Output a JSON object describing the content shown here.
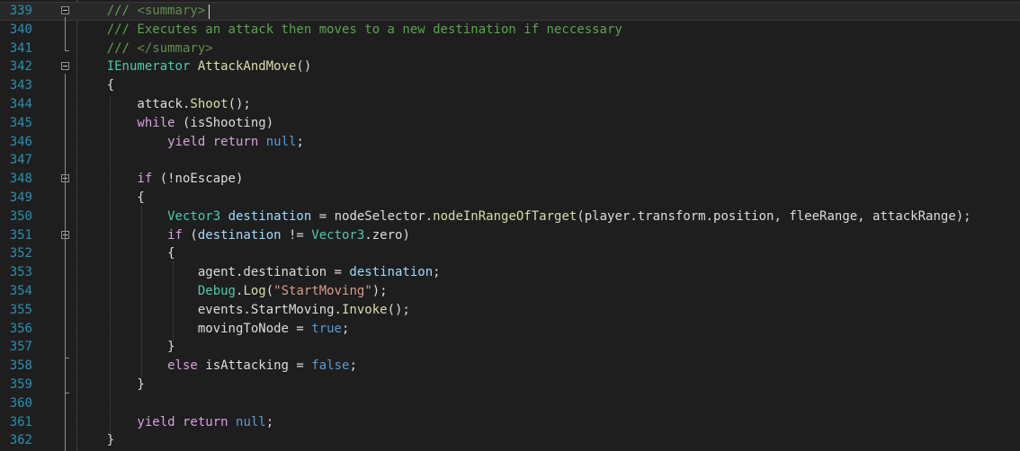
{
  "editor": {
    "theme_colors": {
      "background": "#1e1e1e",
      "line_number": "#2b91af",
      "comment": "#57a64a",
      "keyword": "#569cd6",
      "control_keyword": "#d8a0df",
      "type": "#4ec9b0",
      "method": "#dcdcaa",
      "string": "#d69d85",
      "local_variable": "#9cdcfe",
      "plain": "#dcdcdc"
    },
    "current_line": "339",
    "lines": [
      {
        "n": "339",
        "fold": true,
        "tokens": [
          {
            "t": "/// ",
            "c": "comment"
          },
          {
            "t": "<summary>",
            "c": "xmltag"
          }
        ]
      },
      {
        "n": "340",
        "fold": false,
        "tokens": [
          {
            "t": "/// Executes an attack then moves to a new destination if neccessary",
            "c": "comment"
          }
        ]
      },
      {
        "n": "341",
        "fold": false,
        "tokens": [
          {
            "t": "/// ",
            "c": "comment"
          },
          {
            "t": "</summary>",
            "c": "xmltag"
          }
        ]
      },
      {
        "n": "342",
        "fold": true,
        "tokens": [
          {
            "t": "IEnumerator",
            "c": "type"
          },
          {
            "t": " ",
            "c": "plain"
          },
          {
            "t": "AttackAndMove",
            "c": "method"
          },
          {
            "t": "()",
            "c": "plain"
          }
        ]
      },
      {
        "n": "343",
        "fold": false,
        "tokens": [
          {
            "t": "{",
            "c": "plain"
          }
        ]
      },
      {
        "n": "344",
        "fold": false,
        "tokens": [
          {
            "t": "    attack.",
            "c": "plain"
          },
          {
            "t": "Shoot",
            "c": "method"
          },
          {
            "t": "();",
            "c": "plain"
          }
        ]
      },
      {
        "n": "345",
        "fold": false,
        "tokens": [
          {
            "t": "    ",
            "c": "plain"
          },
          {
            "t": "while",
            "c": "ctrl"
          },
          {
            "t": " (isShooting)",
            "c": "plain"
          }
        ]
      },
      {
        "n": "346",
        "fold": false,
        "tokens": [
          {
            "t": "        ",
            "c": "plain"
          },
          {
            "t": "yield",
            "c": "ctrl"
          },
          {
            "t": " ",
            "c": "plain"
          },
          {
            "t": "return",
            "c": "ctrl"
          },
          {
            "t": " ",
            "c": "plain"
          },
          {
            "t": "null",
            "c": "kw"
          },
          {
            "t": ";",
            "c": "plain"
          }
        ]
      },
      {
        "n": "347",
        "fold": false,
        "tokens": []
      },
      {
        "n": "348",
        "fold": true,
        "tokens": [
          {
            "t": "    ",
            "c": "plain"
          },
          {
            "t": "if",
            "c": "ctrl"
          },
          {
            "t": " (!noEscape)",
            "c": "plain"
          }
        ]
      },
      {
        "n": "349",
        "fold": false,
        "tokens": [
          {
            "t": "    {",
            "c": "plain"
          }
        ]
      },
      {
        "n": "350",
        "fold": false,
        "tokens": [
          {
            "t": "        ",
            "c": "plain"
          },
          {
            "t": "Vector3",
            "c": "type"
          },
          {
            "t": " ",
            "c": "plain"
          },
          {
            "t": "destination",
            "c": "field"
          },
          {
            "t": " = nodeSelector.",
            "c": "plain"
          },
          {
            "t": "nodeInRangeOfTarget",
            "c": "method"
          },
          {
            "t": "(player.transform.position, fleeRange, attackRange);",
            "c": "plain"
          }
        ]
      },
      {
        "n": "351",
        "fold": true,
        "tokens": [
          {
            "t": "        ",
            "c": "plain"
          },
          {
            "t": "if",
            "c": "ctrl"
          },
          {
            "t": " (",
            "c": "plain"
          },
          {
            "t": "destination",
            "c": "field"
          },
          {
            "t": " != ",
            "c": "plain"
          },
          {
            "t": "Vector3",
            "c": "type"
          },
          {
            "t": ".zero)",
            "c": "plain"
          }
        ]
      },
      {
        "n": "352",
        "fold": false,
        "tokens": [
          {
            "t": "        {",
            "c": "plain"
          }
        ]
      },
      {
        "n": "353",
        "fold": false,
        "tokens": [
          {
            "t": "            agent.destination = ",
            "c": "plain"
          },
          {
            "t": "destination",
            "c": "field"
          },
          {
            "t": ";",
            "c": "plain"
          }
        ]
      },
      {
        "n": "354",
        "fold": false,
        "tokens": [
          {
            "t": "            ",
            "c": "plain"
          },
          {
            "t": "Debug",
            "c": "type"
          },
          {
            "t": ".",
            "c": "plain"
          },
          {
            "t": "Log",
            "c": "method"
          },
          {
            "t": "(",
            "c": "plain"
          },
          {
            "t": "\"StartMoving\"",
            "c": "str"
          },
          {
            "t": ");",
            "c": "plain"
          }
        ]
      },
      {
        "n": "355",
        "fold": false,
        "tokens": [
          {
            "t": "            events.StartMoving.",
            "c": "plain"
          },
          {
            "t": "Invoke",
            "c": "method"
          },
          {
            "t": "();",
            "c": "plain"
          }
        ]
      },
      {
        "n": "356",
        "fold": false,
        "tokens": [
          {
            "t": "            movingToNode = ",
            "c": "plain"
          },
          {
            "t": "true",
            "c": "kw"
          },
          {
            "t": ";",
            "c": "plain"
          }
        ]
      },
      {
        "n": "357",
        "fold": false,
        "tokens": [
          {
            "t": "        }",
            "c": "plain"
          }
        ]
      },
      {
        "n": "358",
        "fold": false,
        "tokens": [
          {
            "t": "        ",
            "c": "plain"
          },
          {
            "t": "else",
            "c": "ctrl"
          },
          {
            "t": " isAttacking = ",
            "c": "plain"
          },
          {
            "t": "false",
            "c": "kw"
          },
          {
            "t": ";",
            "c": "plain"
          }
        ]
      },
      {
        "n": "359",
        "fold": false,
        "tokens": [
          {
            "t": "    }",
            "c": "plain"
          }
        ]
      },
      {
        "n": "360",
        "fold": false,
        "tokens": []
      },
      {
        "n": "361",
        "fold": false,
        "tokens": [
          {
            "t": "    ",
            "c": "plain"
          },
          {
            "t": "yield",
            "c": "ctrl"
          },
          {
            "t": " ",
            "c": "plain"
          },
          {
            "t": "return",
            "c": "ctrl"
          },
          {
            "t": " ",
            "c": "plain"
          },
          {
            "t": "null",
            "c": "kw"
          },
          {
            "t": ";",
            "c": "plain"
          }
        ]
      },
      {
        "n": "362",
        "fold": false,
        "tokens": [
          {
            "t": "}",
            "c": "plain"
          }
        ]
      }
    ]
  }
}
